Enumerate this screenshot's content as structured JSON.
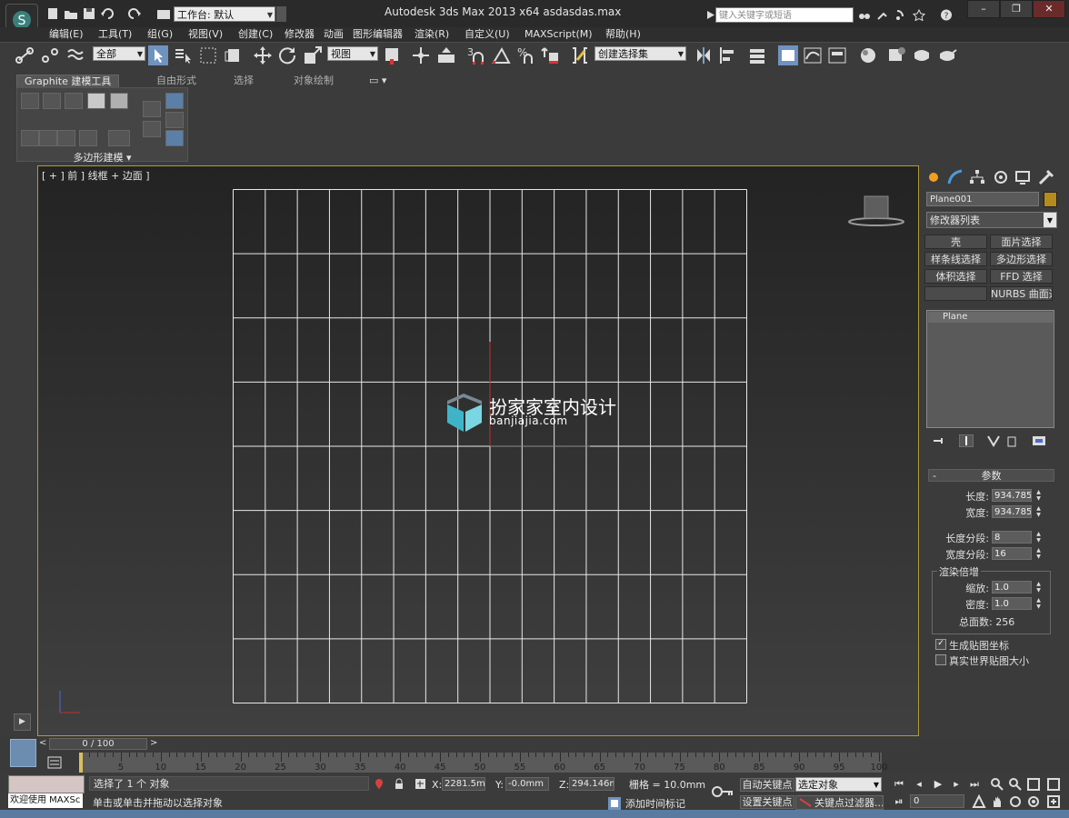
{
  "window": {
    "title": "Autodesk 3ds Max  2013 x64      asdasdas.max",
    "workspace_label": "工作台: 默认",
    "search_placeholder": "键入关键字或短语"
  },
  "menu": [
    "编辑(E)",
    "工具(T)",
    "组(G)",
    "视图(V)",
    "创建(C)",
    "修改器",
    "动画",
    "图形编辑器",
    "渲染(R)",
    "自定义(U)",
    "MAXScript(M)",
    "帮助(H)"
  ],
  "toolbar": {
    "selection_filter": "全部",
    "reference_coord": "视图",
    "named_selection": "创建选择集",
    "snap_percent_label": "%"
  },
  "ribbon": {
    "tabs": [
      "Graphite 建模工具",
      "自由形式",
      "选择",
      "对象绘制"
    ],
    "panel_label": "多边形建模 ▾"
  },
  "viewport": {
    "label": "[ + ] 前 ] 线框 + 边面 ]",
    "watermark_title": "扮家家室内设计",
    "watermark_url": "banjiajia.com",
    "grid_rows": 8,
    "grid_cols": 16
  },
  "command_panel": {
    "object_name": "Plane001",
    "object_color": "#b58b1e",
    "modifier_list": "修改器列表",
    "modifier_buttons": [
      "壳",
      "面片选择",
      "样条线选择",
      "多边形选择",
      "体积选择",
      "FFD 选择",
      "",
      "NURBS 曲面选择"
    ],
    "stack_item": "Plane",
    "params_title": "参数",
    "length_label": "长度:",
    "length_value": "934.785m",
    "width_label": "宽度:",
    "width_value": "934.785m",
    "length_segs_label": "长度分段:",
    "length_segs_value": "8",
    "width_segs_label": "宽度分段:",
    "width_segs_value": "16",
    "render_group_title": "渲染倍增",
    "scale_label": "缩放:",
    "scale_value": "1.0",
    "density_label": "密度:",
    "density_value": "1.0",
    "total_faces": "总面数: 256",
    "gen_map_coords": "生成贴图坐标",
    "real_world_map": "真实世界贴图大小"
  },
  "timeline": {
    "frame_display": "0 / 100",
    "ticks": [
      "5",
      "10",
      "15",
      "20",
      "25",
      "30",
      "35",
      "40",
      "45",
      "50",
      "55",
      "60",
      "65",
      "70",
      "75",
      "80",
      "85",
      "90",
      "95",
      "100"
    ]
  },
  "status": {
    "welcome": "欢迎使用 MAXSc",
    "selection": "选择了 1 个 对象",
    "prompt": "单击或单击并拖动以选择对象",
    "x_label": "X:",
    "x_value": "2281.5mm",
    "y_label": "Y:",
    "y_value": "-0.0mm",
    "z_label": "Z:",
    "z_value": "294.146mm",
    "grid": "栅格 = 10.0mm",
    "add_time_tag": "添加时间标记",
    "auto_key": "自动关键点",
    "set_key": "设置关键点",
    "selected_object": "选定对象",
    "key_filters": "关键点过滤器...",
    "current_frame": "0"
  }
}
